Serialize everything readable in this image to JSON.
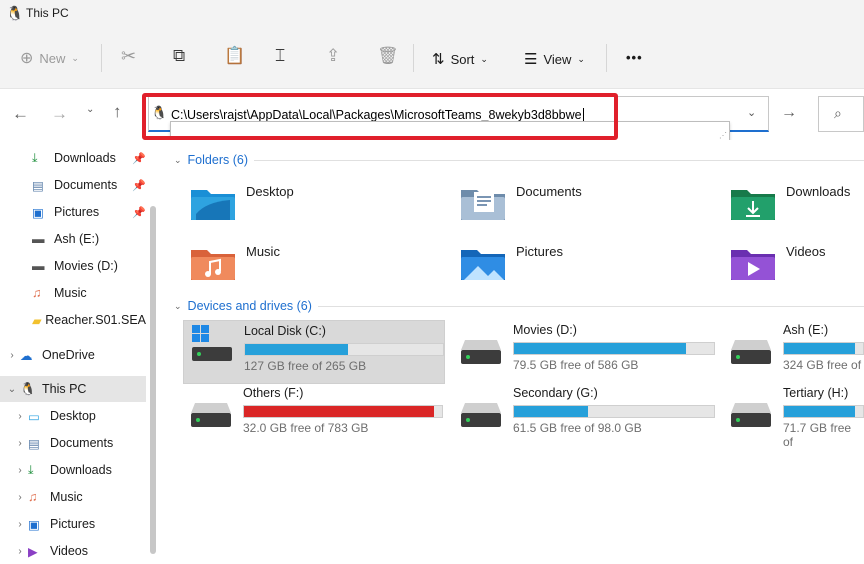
{
  "window": {
    "title": "This PC"
  },
  "toolbar": {
    "new_label": "New",
    "sort_label": "Sort",
    "view_label": "View",
    "more_label": "•••"
  },
  "address": {
    "path": "C:\\Users\\rajst\\AppData\\Local\\Packages\\MicrosoftTeams_8wekyb3d8bbwe"
  },
  "sidebar": {
    "quick": [
      {
        "label": "Downloads",
        "pinned": true
      },
      {
        "label": "Documents",
        "pinned": true
      },
      {
        "label": "Pictures",
        "pinned": true
      },
      {
        "label": "Ash (E:)",
        "pinned": false
      },
      {
        "label": "Movies (D:)",
        "pinned": false
      },
      {
        "label": "Music",
        "pinned": false
      },
      {
        "label": "Reacher.S01.SEA",
        "pinned": false
      }
    ],
    "onedrive": "OneDrive",
    "thispc": "This PC",
    "thispc_children": [
      "Desktop",
      "Documents",
      "Downloads",
      "Music",
      "Pictures",
      "Videos"
    ]
  },
  "main": {
    "folders_header": "Folders (6)",
    "folders": [
      "Desktop",
      "Documents",
      "Downloads",
      "Music",
      "Pictures",
      "Videos"
    ],
    "drives_header": "Devices and drives (6)",
    "drives": [
      {
        "name": "Local Disk (C:)",
        "free": "127 GB free of 265 GB",
        "used_fraction": 0.52,
        "color": "#26a0da",
        "selected": true
      },
      {
        "name": "Movies (D:)",
        "free": "79.5 GB free of 586 GB",
        "used_fraction": 0.86,
        "color": "#26a0da"
      },
      {
        "name": "Ash (E:)",
        "free": "324 GB free of",
        "used_fraction": 0.9,
        "color": "#26a0da"
      },
      {
        "name": "Others (F:)",
        "free": "32.0 GB free of 783 GB",
        "used_fraction": 0.96,
        "color": "#da2626"
      },
      {
        "name": "Secondary (G:)",
        "free": "61.5 GB free of 98.0 GB",
        "used_fraction": 0.37,
        "color": "#26a0da"
      },
      {
        "name": "Tertiary (H:)",
        "free": "71.7 GB free of",
        "used_fraction": 0.9,
        "color": "#26a0da"
      }
    ]
  }
}
